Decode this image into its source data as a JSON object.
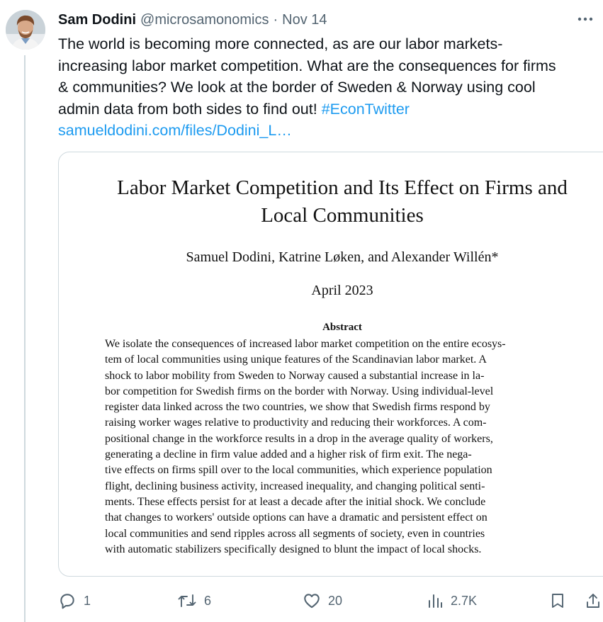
{
  "tweet": {
    "author_name": "Sam Dodini",
    "handle": "@microsamonomics",
    "separator": "·",
    "date": "Nov 14",
    "more_label": "···",
    "text_lines": [
      "The world is becoming more connected, as are our labor markets-",
      "increasing labor market competition. What are the consequences for firms",
      "& communities? We look at the border of Sweden & Norway using cool",
      "admin data from both sides to find out! "
    ],
    "hashtag": "#EconTwitter",
    "link": "samueldodini.com/files/Dodini_L…"
  },
  "media": {
    "title_line1": "Labor Market Competition and Its Effect on Firms and",
    "title_line2": "Local Communities",
    "authors": "Samuel Dodini, Katrine Løken, and Alexander Willén*",
    "date": "April 2023",
    "abstract_heading": "Abstract",
    "abstract_lines": [
      "We isolate the consequences of increased labor market competition on the entire ecosys-",
      "tem of local communities using unique features of the Scandinavian labor market. A",
      "shock to labor mobility from Sweden to Norway caused a substantial increase in la-",
      "bor competition for Swedish firms on the border with Norway. Using individual-level",
      "register data linked across the two countries, we show that Swedish firms respond by",
      "raising worker wages relative to productivity and reducing their workforces. A com-",
      "positional change in the workforce results in a drop in the average quality of workers,",
      "generating a decline in firm value added and a higher risk of firm exit. The nega-",
      "tive effects on firms spill over to the local communities, which experience population",
      "flight, declining business activity, increased inequality, and changing political senti-",
      "ments. These effects persist for at least a decade after the initial shock. We conclude",
      "that changes to workers' outside options can have a dramatic and persistent effect on",
      "local communities and send ripples across all segments of society, even in countries",
      "with automatic stabilizers specifically designed to blunt the impact of local shocks."
    ]
  },
  "actions": {
    "reply_count": "1",
    "retweet_count": "6",
    "like_count": "20",
    "view_count": "2.7K"
  },
  "colors": {
    "text": "#0f1419",
    "secondary": "#536471",
    "link": "#1d9bf0",
    "border": "#cfd9de"
  },
  "icons": [
    "more-icon",
    "reply-icon",
    "retweet-icon",
    "like-icon",
    "views-icon",
    "bookmark-icon",
    "share-icon"
  ]
}
